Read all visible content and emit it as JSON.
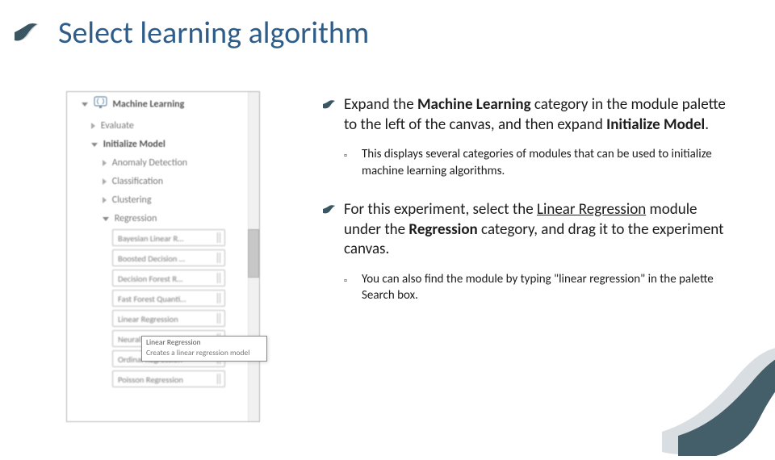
{
  "title": "Select learning algorithm",
  "palette": {
    "root": "Machine Learning",
    "evaluate": "Evaluate",
    "init": "Initialize Model",
    "cats": {
      "anomaly": "Anomaly Detection",
      "classification": "Classification",
      "clustering": "Clustering",
      "regression": "Regression"
    },
    "modules": [
      "Bayesian Linear R…",
      "Boosted Decision …",
      "Decision Forest R…",
      "Fast Forest Quanti…",
      "Linear Regression",
      "Neural Ne",
      "Ordinal Regression",
      "Poisson Regression"
    ],
    "tooltip": {
      "title": "Linear Regression",
      "body": "Creates a linear regression model"
    }
  },
  "content": {
    "b1_pre": "Expand the ",
    "b1_ml": "Machine Learning",
    "b1_mid": " category in the module palette to the left of the canvas, and then expand ",
    "b1_im": "Initialize Model",
    "b1_post": ".",
    "s1": "This displays several categories of modules that can be used to initialize machine learning algorithms.",
    "b2_pre": "For this experiment, select the ",
    "b2_link": "Linear Regression",
    "b2_mid": " module under the ",
    "b2_reg": "Regression",
    "b2_post": " category, and drag it to the experiment canvas.",
    "s2": "You can also find the module by typing \"linear regression\" in the palette Search box."
  }
}
